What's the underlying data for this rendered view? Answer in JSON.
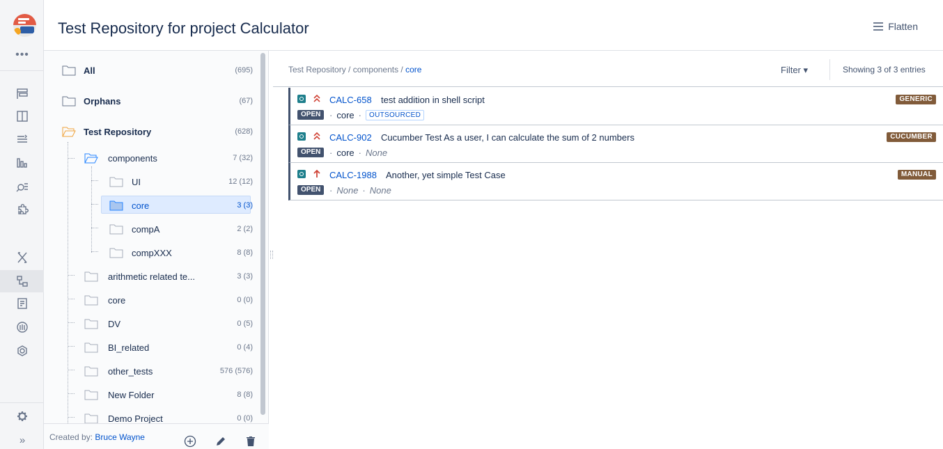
{
  "header": {
    "title": "Test Repository for project Calculator",
    "flatten_label": "Flatten"
  },
  "rail": {
    "more_label": "•••",
    "expand_label": "»",
    "icons": [
      "board-icon",
      "columns-icon",
      "backlog-icon",
      "reports-icon",
      "search-issues-icon",
      "puzzle-icon",
      "xray-icon",
      "test-repository-icon",
      "test-plan-icon",
      "coverage-icon",
      "settings-ring-icon",
      "gear-icon"
    ]
  },
  "tree": {
    "items": [
      {
        "label": "All",
        "count": "(695)"
      },
      {
        "label": "Orphans",
        "count": "(67)"
      },
      {
        "label": "Test Repository",
        "count": "(628)"
      },
      {
        "label": "components",
        "count": "7 (32)"
      },
      {
        "label": "UI",
        "count": "12 (12)"
      },
      {
        "label": "core",
        "count": "3 (3)"
      },
      {
        "label": "compA",
        "count": "2 (2)"
      },
      {
        "label": "compXXX",
        "count": "8 (8)"
      },
      {
        "label": "arithmetic related te...",
        "count": "3 (3)"
      },
      {
        "label": "core",
        "count": "0 (0)"
      },
      {
        "label": "DV",
        "count": "0 (5)"
      },
      {
        "label": "BI_related",
        "count": "0 (4)"
      },
      {
        "label": "other_tests",
        "count": "576 (576)"
      },
      {
        "label": "New Folder",
        "count": "8 (8)"
      },
      {
        "label": "Demo Project",
        "count": "0 (0)"
      }
    ],
    "footer": {
      "created_prefix": "Created by:",
      "created_by": "Bruce Wayne"
    }
  },
  "main": {
    "breadcrumb": {
      "root": "Test Repository",
      "sep": " / ",
      "mid": "components",
      "current": "core"
    },
    "filter_label": "Filter ▾",
    "showing": "Showing 3 of 3 entries",
    "issues": [
      {
        "key": "CALC-658",
        "summary": "test addition in shell script",
        "tag": "GENERIC",
        "status": "OPEN",
        "component": "core",
        "label": "OUTSOURCED",
        "priority_color": "#d04437"
      },
      {
        "key": "CALC-902",
        "summary": "Cucumber Test As a user, I can calculate the sum of 2 numbers",
        "tag": "CUCUMBER",
        "status": "OPEN",
        "component": "core",
        "label": "None",
        "priority_color": "#d04437"
      },
      {
        "key": "CALC-1988",
        "summary": "Another, yet simple Test Case",
        "tag": "MANUAL",
        "status": "OPEN",
        "component": "None",
        "label": "None",
        "priority_color": "#d04437"
      }
    ]
  }
}
